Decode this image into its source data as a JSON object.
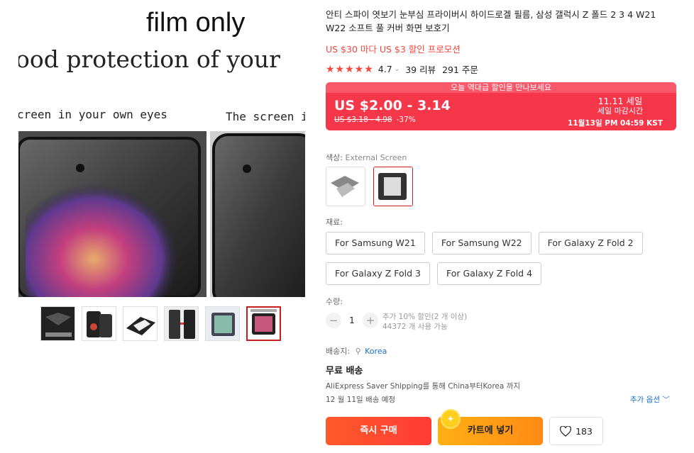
{
  "gallery": {
    "banner_line1": "film only",
    "banner_line2": "ood protection of your",
    "left_caption": "creen in your own eyes",
    "right_caption": "The screen i",
    "thumbnail_count": 6,
    "active_thumbnail": 6
  },
  "product": {
    "title": "안티 스파이 엿보기 눈부심 프라이버시 하이드로겔 필름, 삼성 갤럭시 Z 폴드 2 3 4 W21 W22 소프트 풀 커버 화면 보호기",
    "promo": "US $30 마다 US $3 할인 프로모션",
    "rating_value": "4.7",
    "rating_stars": 5,
    "reviews": "39 리뷰",
    "orders": "291 주문"
  },
  "deal": {
    "banner": "오늘 역대급 할인을 만나보세요",
    "price": "US $2.00 - 3.14",
    "original_price": "US $3.18 - 4.98",
    "discount": "-37%",
    "sale_name": "11.11 세일",
    "sale_sub": "세일 마감시간",
    "countdown": "11월13일 PM 04:59 KST"
  },
  "color": {
    "label": "색상:",
    "selected": "External Screen"
  },
  "material": {
    "label": "재료:",
    "options": [
      "For Samsung W21",
      "For Samsung W22",
      "For Galaxy Z Fold 2",
      "For Galaxy Z Fold 3",
      "For Galaxy Z Fold 4"
    ]
  },
  "quantity": {
    "label": "수량:",
    "value": "1",
    "minus": "−",
    "plus": "+",
    "extra_discount": "추가 10% 할인(2 개 이상)",
    "available": "44372 개 사용 가능"
  },
  "shipping": {
    "ship_to_label": "배송지:",
    "country": "Korea",
    "free": "무료 배송",
    "via": "AliExpress Saver Shipping를 통해 China부터Korea 까지",
    "eta": "12 월 11일 배송 예정",
    "more_options": "추가 옵션"
  },
  "actions": {
    "buy_now": "즉시 구매",
    "add_to_cart": "카트에 넣기",
    "wishlist_count": "183"
  },
  "colors": {
    "accent_red": "#f6374a",
    "buy_orange": "#ff4a30",
    "cart_yellow": "#ff9f16",
    "link_blue": "#1a6fc9"
  }
}
